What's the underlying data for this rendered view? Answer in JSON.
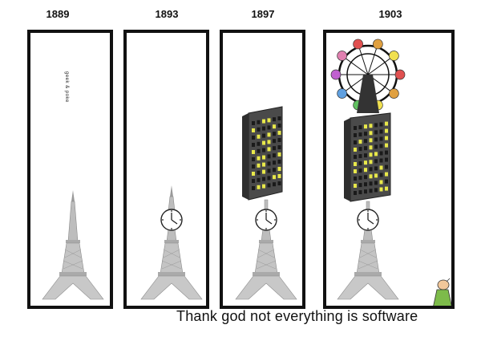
{
  "panels": [
    {
      "year": "1889"
    },
    {
      "year": "1893"
    },
    {
      "year": "1897"
    },
    {
      "year": "1903"
    }
  ],
  "credit": "geek & poke",
  "caption": "Thank god not everything is software",
  "colors": {
    "frame": "#111111",
    "tower": "#b8b8b8",
    "building": "#4a4a4a",
    "window_lit": "#e8e84a",
    "ferris_cabins": [
      "#e05050",
      "#e0a040",
      "#f0e050",
      "#60c060",
      "#60a0e0",
      "#c060d0",
      "#e080b0"
    ]
  }
}
